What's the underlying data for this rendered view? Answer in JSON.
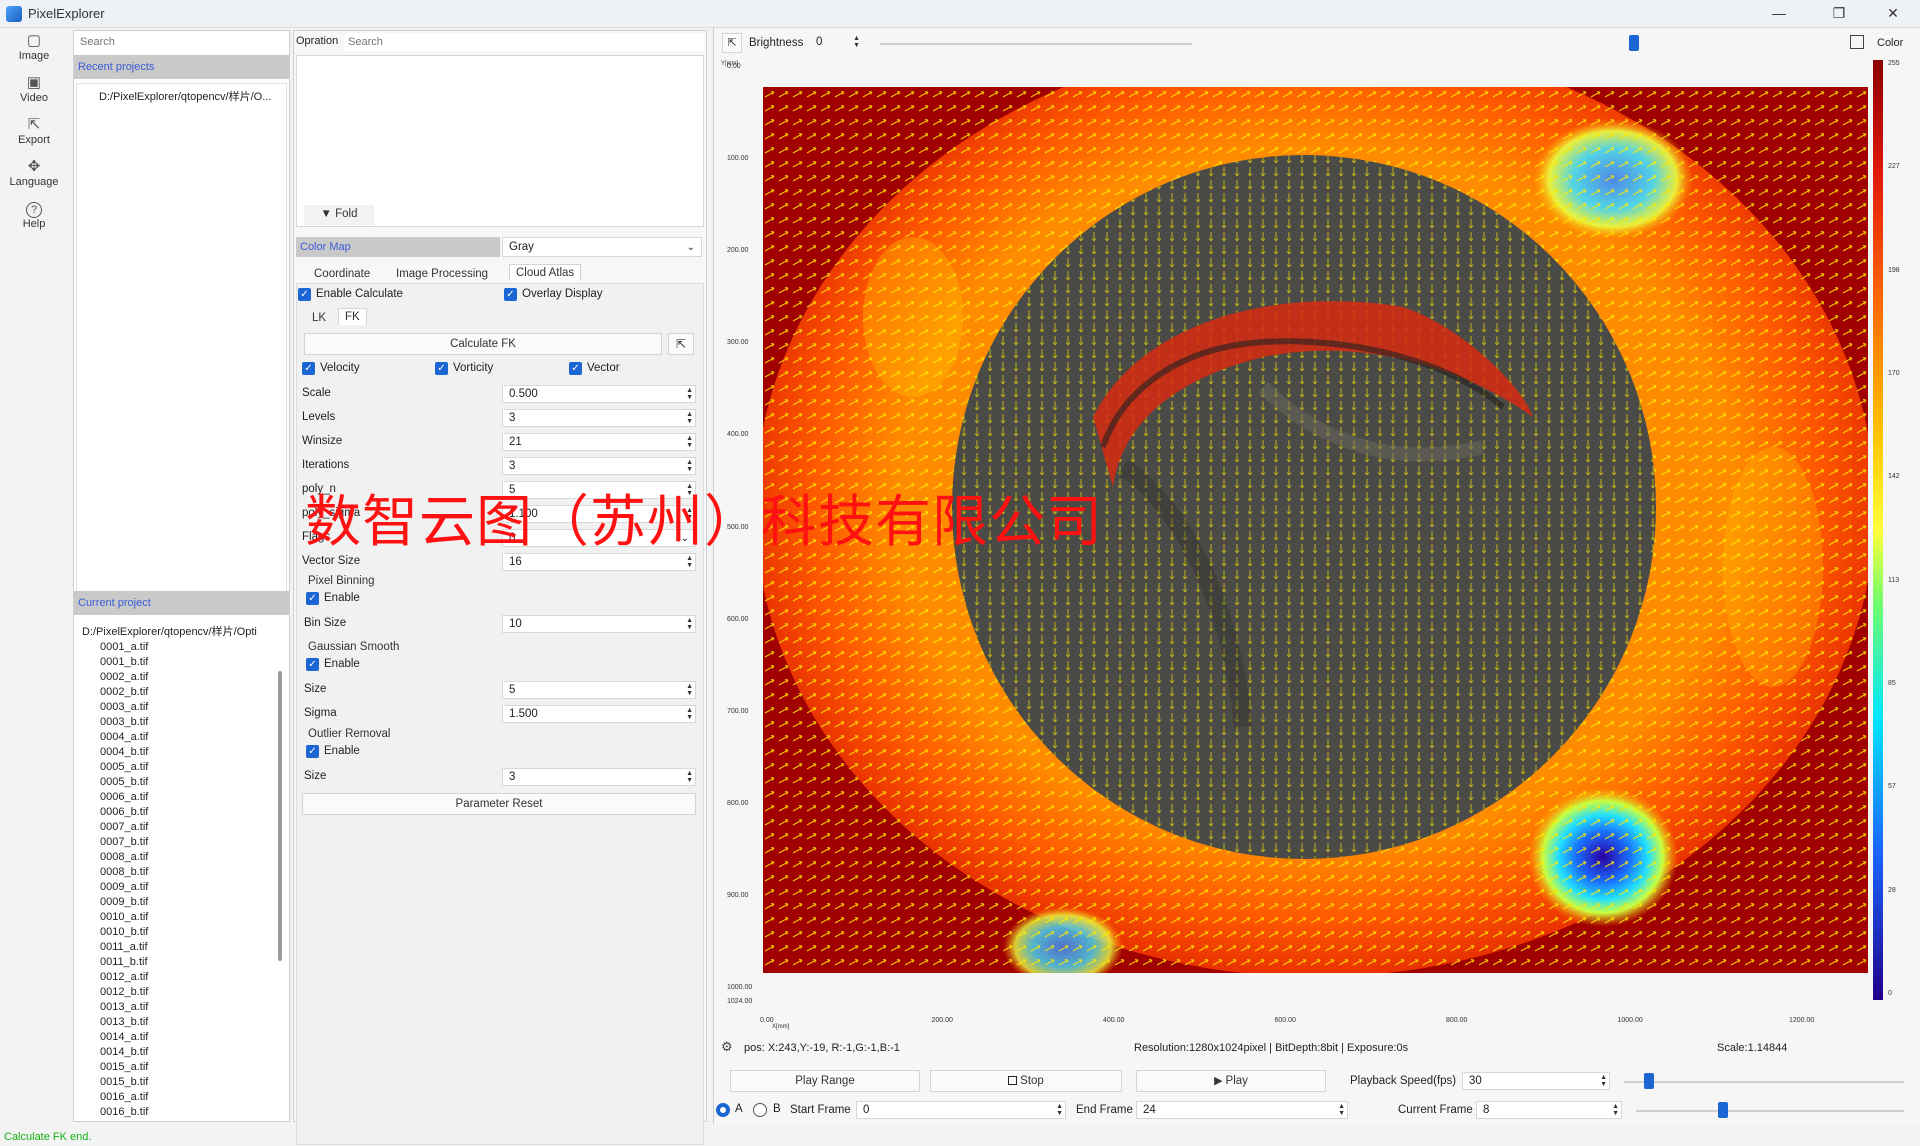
{
  "window": {
    "title": "PixelExplorer",
    "minimize": "—",
    "maximize": "❐",
    "close": "✕"
  },
  "nav": [
    {
      "label": "Image",
      "icon": "image-icon",
      "glyph": "▢"
    },
    {
      "label": "Video",
      "icon": "video-icon",
      "glyph": "▣"
    },
    {
      "label": "Export",
      "icon": "export-icon",
      "glyph": "⇱"
    },
    {
      "label": "Language",
      "icon": "language-icon",
      "glyph": "✥"
    },
    {
      "label": "Help",
      "icon": "help-icon",
      "glyph": "?"
    }
  ],
  "projects": {
    "search_placeholder": "Search",
    "recent_title": "Recent projects",
    "recent_items": [
      "D:/PixelExplorer/qtopencv/样片/O..."
    ],
    "current_title": "Current project",
    "current_root": "D:/PixelExplorer/qtopencv/样片/Opti",
    "files": [
      "0001_a.tif",
      "0001_b.tif",
      "0002_a.tif",
      "0002_b.tif",
      "0003_a.tif",
      "0003_b.tif",
      "0004_a.tif",
      "0004_b.tif",
      "0005_a.tif",
      "0005_b.tif",
      "0006_a.tif",
      "0006_b.tif",
      "0007_a.tif",
      "0007_b.tif",
      "0008_a.tif",
      "0008_b.tif",
      "0009_a.tif",
      "0009_b.tif",
      "0010_a.tif",
      "0010_b.tif",
      "0011_a.tif",
      "0011_b.tif",
      "0012_a.tif",
      "0012_b.tif",
      "0013_a.tif",
      "0013_b.tif",
      "0014_a.tif",
      "0014_b.tif",
      "0015_a.tif",
      "0015_b.tif",
      "0016_a.tif",
      "0016_b.tif"
    ]
  },
  "operation": {
    "label": "Opration",
    "search_placeholder": "Search",
    "fold": "▼ Fold",
    "colormap_label": "Color Map",
    "colormap_value": "Gray",
    "tabs": [
      "Coordinate",
      "Image Processing",
      "Cloud Atlas"
    ],
    "enable_calculate": "Enable Calculate",
    "overlay_display": "Overlay Display",
    "subtabs": [
      "LK",
      "FK"
    ],
    "calculate_button": "Calculate FK",
    "velocity": "Velocity",
    "vorticity": "Vorticity",
    "vector": "Vector",
    "params": [
      {
        "label": "Scale",
        "value": "0.500"
      },
      {
        "label": "Levels",
        "value": "3"
      },
      {
        "label": "Winsize",
        "value": "21"
      },
      {
        "label": "Iterations",
        "value": "3"
      },
      {
        "label": "poly_n",
        "value": "5"
      },
      {
        "label": "poly_sigma",
        "value": "1.100"
      },
      {
        "label": "Flags",
        "value": "0"
      },
      {
        "label": "Vector Size",
        "value": "16"
      }
    ],
    "pixel_binning": {
      "title": "Pixel Binning",
      "enable": "Enable",
      "bin_label": "Bin Size",
      "bin_value": "10"
    },
    "gaussian": {
      "title": "Gaussian Smooth",
      "enable": "Enable",
      "size_label": "Size",
      "size_value": "5",
      "sigma_label": "Sigma",
      "sigma_value": "1.500"
    },
    "outlier": {
      "title": "Outlier Removal",
      "enable": "Enable",
      "size_label": "Size",
      "size_value": "3"
    },
    "reset": "Parameter Reset"
  },
  "viewer": {
    "brightness_label": "Brightness",
    "brightness_value": "0",
    "brightness_level": 0.5,
    "color_label": "Color",
    "y_axis_unit": "Y[mm]",
    "x_axis_unit": "X[mm]",
    "y_ticks": [
      "0.00",
      "100.00",
      "200.00",
      "300.00",
      "400.00",
      "500.00",
      "600.00",
      "700.00",
      "800.00",
      "900.00",
      "1000.00",
      "1024.00"
    ],
    "x_ticks": [
      "0.00",
      "200.00",
      "400.00",
      "600.00",
      "800.00",
      "1000.00",
      "1200.00"
    ],
    "colorbar_ticks": [
      "255",
      "227",
      "198",
      "170",
      "142",
      "113",
      "85",
      "57",
      "28",
      "0"
    ],
    "pos": "pos: X:243,Y:-19, R:-1,G:-1,B:-1",
    "resolution": "Resolution:1280x1024pixel | BitDepth:8bit | Exposure:0s",
    "scale": "Scale:1.14844",
    "play_range": "Play Range",
    "stop": "Stop",
    "play": "Play",
    "playback_label": "Playback Speed(fps)",
    "playback_value": "30",
    "playback_level": 0.5,
    "radio_a": "A",
    "radio_b": "B",
    "start_label": "Start Frame",
    "start_value": "0",
    "end_label": "End Frame",
    "end_value": "24",
    "current_label": "Current Frame",
    "current_value": "8",
    "current_level": 0.33
  },
  "overlay_text": "数智云图（苏州）科技有限公司",
  "status": "Calculate FK end."
}
